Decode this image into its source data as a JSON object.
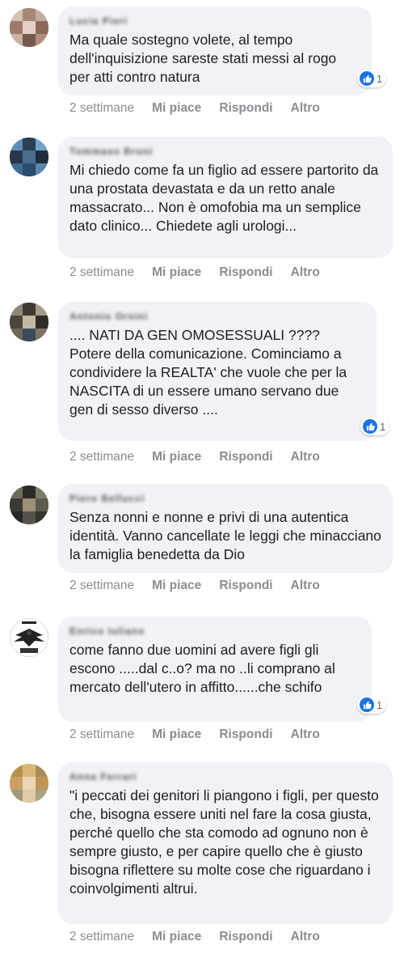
{
  "comments": [
    {
      "author": "Lucia Pieri",
      "text": "Ma quale sostegno volete, al tempo dell'inquisizione sareste stati messi al rogo per atti contro natura",
      "reactions": "1",
      "time": "2 settimane",
      "like": "Mi piace",
      "reply": "Rispondi",
      "more": "Altro"
    },
    {
      "author": "Tommaso Bruni",
      "text": "Mi chiedo come fa un figlio ad essere partorito da una prostata devastata e da un retto anale massacrato... Non è omofobia ma un semplice dato clinico... Chiedete agli urologi...",
      "time": "2 settimane",
      "like": "Mi piace",
      "reply": "Rispondi",
      "more": "Altro"
    },
    {
      "author": "Antonio Orsini",
      "text": ".... NATI DA GEN OMOSESSUALI ???? Potere della comunicazione. Cominciamo a condividere la REALTA' che vuole che per la NASCITA di un essere umano servano due gen di sesso diverso ....",
      "reactions": "1",
      "time": "2 settimane",
      "like": "Mi piace",
      "reply": "Rispondi",
      "more": "Altro"
    },
    {
      "author": "Piero Bellucci",
      "text": "Senza nonni e nonne e privi di una autentica identità. Vanno cancellate le leggi che minacciano la famiglia benedetta da Dio",
      "time": "2 settimane",
      "like": "Mi piace",
      "reply": "Rispondi",
      "more": "Altro"
    },
    {
      "author": "Enrico Iuliano",
      "text": "come fanno due uomini ad avere figli gli escono .....dal c..o? ma no ..li comprano al mercato dell'utero in affitto......che schifo",
      "reactions": "1",
      "time": "2 settimane",
      "like": "Mi piace",
      "reply": "Rispondi",
      "more": "Altro"
    },
    {
      "author": "Anna Ferrari",
      "text": "\"i peccati dei genitori li piangono i figli, per questo che, bisogna essere uniti nel fare la cosa giusta, perché quello che sta comodo ad ognuno non è sempre giusto, e per capire quello che è giusto bisogna riflettere su molte cose che riguardano i coinvolgimenti altrui.",
      "time": "2 settimane",
      "like": "Mi piace",
      "reply": "Rispondi",
      "more": "Altro"
    }
  ],
  "colors": {
    "bubble": "#f0f2f5",
    "like_blue": "#1b74e4",
    "meta": "#8a8d91"
  }
}
